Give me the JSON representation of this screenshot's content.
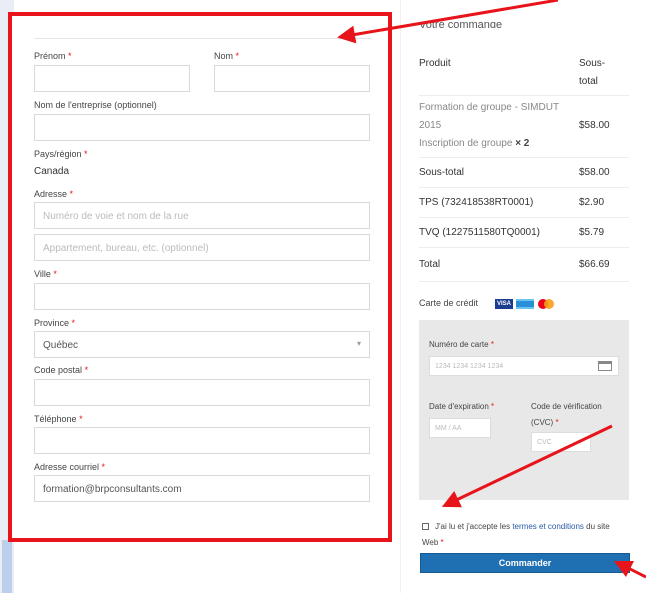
{
  "form": {
    "prenom_label": "Prénom",
    "nom_label": "Nom",
    "entreprise_label": "Nom de l'entreprise (optionnel)",
    "pays_label": "Pays/région",
    "pays_value": "Canada",
    "adresse_label": "Adresse",
    "adresse_placeholder": "Numéro de voie et nom de la rue",
    "adresse2_placeholder": "Appartement, bureau, etc. (optionnel)",
    "ville_label": "Ville",
    "province_label": "Province",
    "province_value": "Québec",
    "code_postal_label": "Code postal",
    "telephone_label": "Téléphone",
    "courriel_label": "Adresse courriel",
    "courriel_value": "formation@brpconsultants.com",
    "required_mark": "*"
  },
  "order": {
    "title": "Votre commande",
    "col_product": "Produit",
    "col_subtotal_1": "Sous-",
    "col_subtotal_2": "total",
    "item_line1": "Formation de groupe - SIMDUT",
    "item_line2": "2015",
    "item_line3": "Inscription de groupe",
    "item_qty": "× 2",
    "item_price": "$58.00",
    "subtotal_label": "Sous-total",
    "subtotal_value": "$58.00",
    "tps_label": "TPS (732418538RT0001)",
    "tps_value": "$2.90",
    "tvq_label": "TVQ (1227511580TQ0001)",
    "tvq_value": "$5.79",
    "total_label": "Total",
    "total_value": "$66.69"
  },
  "payment": {
    "method_label": "Carte de crédit",
    "card_number_label": "Numéro de carte",
    "card_number_placeholder": "1234 1234 1234 1234",
    "expiry_label": "Date d'expiration",
    "expiry_placeholder": "MM / AA",
    "cvc_label_1": "Code de vérification",
    "cvc_label_2": "(CVC)",
    "cvc_placeholder": "CVC",
    "visa_text": "VISA"
  },
  "terms": {
    "prefix": "J'ai lu et j'accepte les",
    "link": "termes et conditions",
    "suffix": "du site",
    "line2": "Web"
  },
  "submit_label": "Commander",
  "colors": {
    "annotation_red": "#e8141b",
    "button_blue": "#1f6fb3",
    "link_blue": "#2b5aa8"
  }
}
